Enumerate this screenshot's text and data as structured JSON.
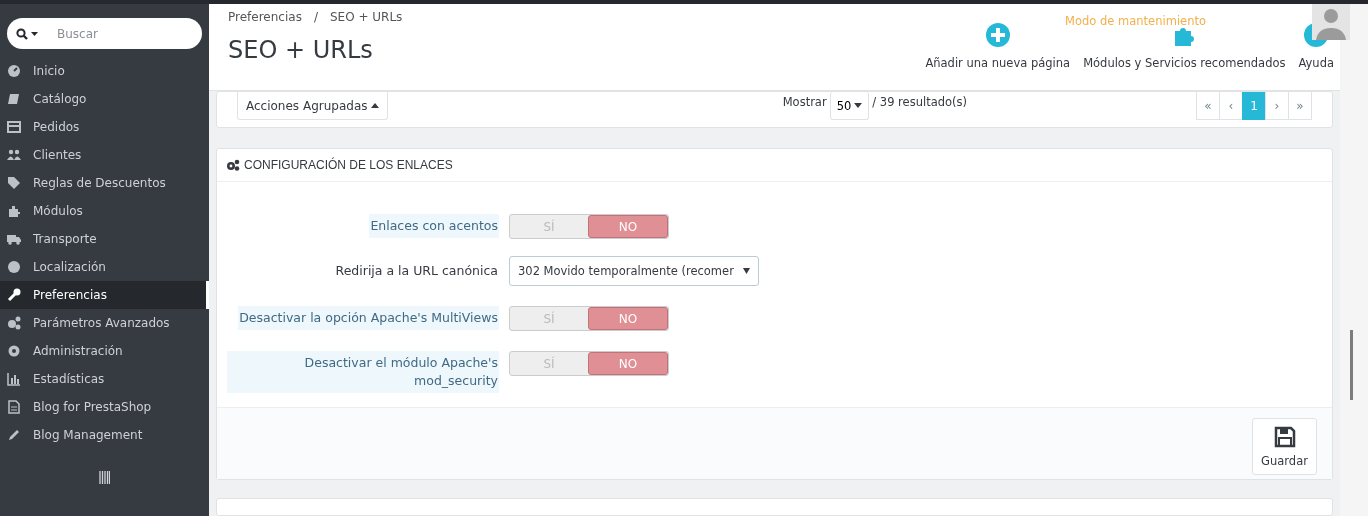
{
  "sidebar": {
    "search": {
      "placeholder": "Buscar"
    },
    "items": [
      {
        "label": "Inicio",
        "selected": false
      },
      {
        "label": "Catálogo",
        "selected": false
      },
      {
        "label": "Pedidos",
        "selected": false
      },
      {
        "label": "Clientes",
        "selected": false
      },
      {
        "label": "Reglas de Descuentos",
        "selected": false
      },
      {
        "label": "Módulos",
        "selected": false
      },
      {
        "label": "Transporte",
        "selected": false
      },
      {
        "label": "Localización",
        "selected": false
      },
      {
        "label": "Preferencias",
        "selected": true
      },
      {
        "label": "Parámetros Avanzados",
        "selected": false
      },
      {
        "label": "Administración",
        "selected": false
      },
      {
        "label": "Estadísticas",
        "selected": false
      },
      {
        "label": "Blog for PrestaShop",
        "selected": false
      },
      {
        "label": "Blog Management",
        "selected": false
      }
    ]
  },
  "header": {
    "breadcrumb": [
      "Preferencias",
      "/",
      "SEO + URLs"
    ],
    "title": "SEO + URLs",
    "maintenance": "Modo de mantenimiento",
    "actions": [
      {
        "label": "Añadir una nueva página"
      },
      {
        "label": "Módulos y Servicios recomendados"
      },
      {
        "label": "Ayuda"
      }
    ]
  },
  "list_footer": {
    "bulk_actions": "Acciones Agrupadas",
    "show_label": "Mostrar",
    "per_page": "50",
    "results": "/ 39 resultado(s)",
    "pagination": [
      {
        "label": "«",
        "selected": false
      },
      {
        "label": "‹",
        "selected": false
      },
      {
        "label": "1",
        "selected": true
      },
      {
        "label": "›",
        "selected": false
      },
      {
        "label": "»",
        "selected": false
      }
    ]
  },
  "panel": {
    "title": "CONFIGURACIÓN DE LOS ENLACES",
    "rows": [
      {
        "kind": "switch",
        "label": "Enlaces con acentos",
        "hint": true,
        "options": [
          {
            "label": "SÍ",
            "selected": false
          },
          {
            "label": "NO",
            "selected": true
          }
        ]
      },
      {
        "kind": "select",
        "label": "Redirija a la URL canónica",
        "hint": false,
        "value": "302 Movido temporalmente (recomer"
      },
      {
        "kind": "switch",
        "label": "Desactivar la opción Apache's MultiViews",
        "hint": true,
        "options": [
          {
            "label": "SÍ",
            "selected": false
          },
          {
            "label": "NO",
            "selected": true
          }
        ]
      },
      {
        "kind": "switch",
        "label": "Desactivar el módulo Apache's mod_security",
        "hint": true,
        "options": [
          {
            "label": "SÍ",
            "selected": false
          },
          {
            "label": "NO",
            "selected": true
          }
        ]
      }
    ],
    "save": "Guardar"
  }
}
